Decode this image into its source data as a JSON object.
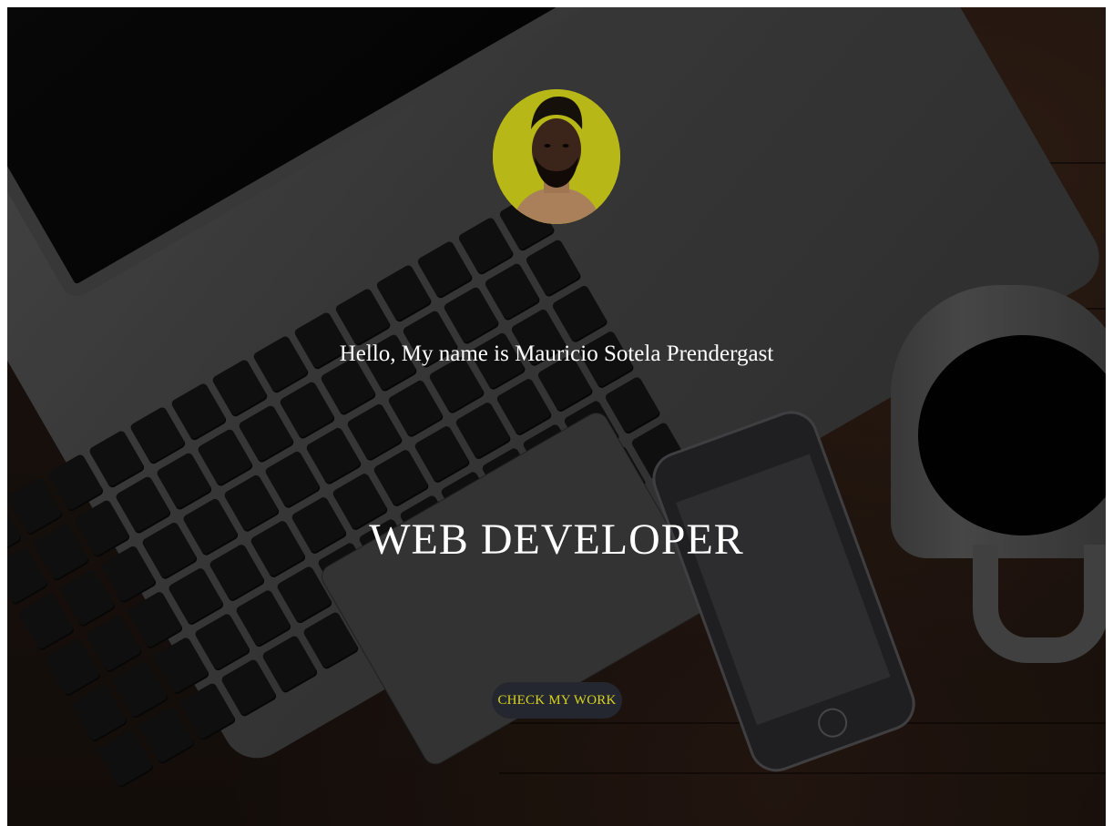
{
  "hero": {
    "greeting": "Hello, My name is Mauricio Sotela Prendergast",
    "title": "WEB DEVELOPER",
    "cta_label": "CHECK MY WORK",
    "avatar_alt": "Mauricio Sotela Prendergast"
  },
  "colors": {
    "text": "#ffffff",
    "cta_text": "#d8d21e",
    "cta_background": "#242730",
    "avatar_background": "#b7b817"
  }
}
